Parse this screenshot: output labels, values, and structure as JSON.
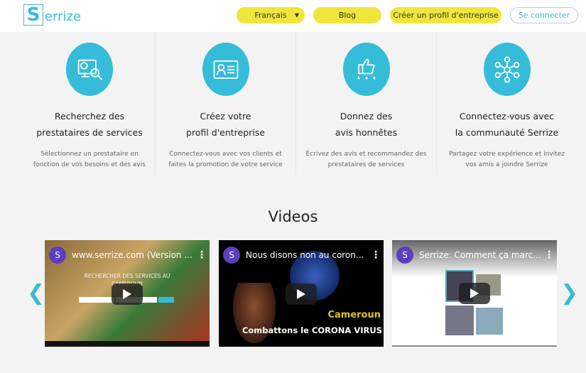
{
  "header": {
    "logo_letter": "S",
    "logo_text": "errize",
    "language": "Français",
    "blog": "Blog",
    "create_profile": "Créer un profil d'entreprise",
    "login": "Se connecter"
  },
  "features": [
    {
      "icon": "computer-search-icon",
      "title1": "Recherchez des",
      "title2": "prestataires de services",
      "desc1": "Sélectionnez un prestataire en",
      "desc2": "fonction de vos besoins et des avis"
    },
    {
      "icon": "profile-card-icon",
      "title1": "Créez votre",
      "title2": "profil d'entreprise",
      "desc1": "Connectez-vous avec vos clients et",
      "desc2": "faites la promotion de votre service"
    },
    {
      "icon": "thumbs-up-stars-icon",
      "title1": "Donnez des",
      "title2": "avis honnêtes",
      "desc1": "Ecrivez des avis et recommandez des",
      "desc2": "prestataires de services"
    },
    {
      "icon": "community-network-icon",
      "title1": "Connectez-vous avec",
      "title2": "la communauté Serrize",
      "desc1": "Partagez votre expérience et invitez",
      "desc2": "vos amis a joindre Serrize"
    }
  ],
  "videos_title": "Videos",
  "videos": [
    {
      "channel": "S",
      "title": "www.serrize.com (Version ...",
      "overlay1": "RECHERCHER DES SERVICES AU",
      "overlay2": "CAMEROUN"
    },
    {
      "channel": "S",
      "title": "Nous disons non au coron...",
      "overlay1": "Cameroun",
      "overlay2": "Combattons le CORONA VIRUS"
    },
    {
      "channel": "S",
      "title": "Serrize: Comment ça marc..."
    }
  ],
  "nav": {
    "prev": "❮",
    "next": "❯"
  }
}
